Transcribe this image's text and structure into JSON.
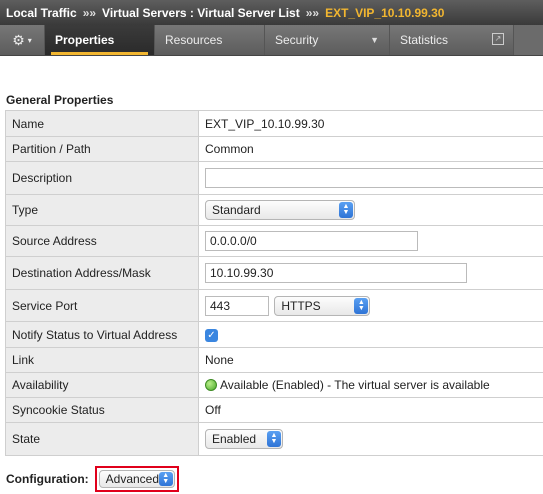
{
  "breadcrumb": {
    "items": [
      "Local Traffic",
      "Virtual Servers : Virtual Server List"
    ],
    "current": "EXT_VIP_10.10.99.30",
    "separator": "»»"
  },
  "tabs": [
    {
      "label": "Properties",
      "active": true
    },
    {
      "label": "Resources"
    },
    {
      "label": "Security",
      "dropdown": true
    },
    {
      "label": "Statistics",
      "external": true
    }
  ],
  "section_title": "General Properties",
  "properties": {
    "name": {
      "label": "Name",
      "value": "EXT_VIP_10.10.99.30"
    },
    "partition": {
      "label": "Partition / Path",
      "value": "Common"
    },
    "description": {
      "label": "Description",
      "value": ""
    },
    "type": {
      "label": "Type",
      "value": "Standard"
    },
    "source": {
      "label": "Source Address",
      "value": "0.0.0.0/0"
    },
    "destination": {
      "label": "Destination Address/Mask",
      "value": "10.10.99.30"
    },
    "service_port": {
      "label": "Service Port",
      "port": "443",
      "protocol": "HTTPS"
    },
    "notify": {
      "label": "Notify Status to Virtual Address",
      "checked": true
    },
    "link": {
      "label": "Link",
      "value": "None"
    },
    "availability": {
      "label": "Availability",
      "value": "Available (Enabled) - The virtual server is available"
    },
    "syncookie": {
      "label": "Syncookie Status",
      "value": "Off"
    },
    "state": {
      "label": "State",
      "value": "Enabled"
    }
  },
  "configuration": {
    "label": "Configuration:",
    "value": "Advanced"
  },
  "colors": {
    "accent": "#f2b630",
    "highlight": "#e0001b",
    "select_arrow": "#2f74d6"
  }
}
